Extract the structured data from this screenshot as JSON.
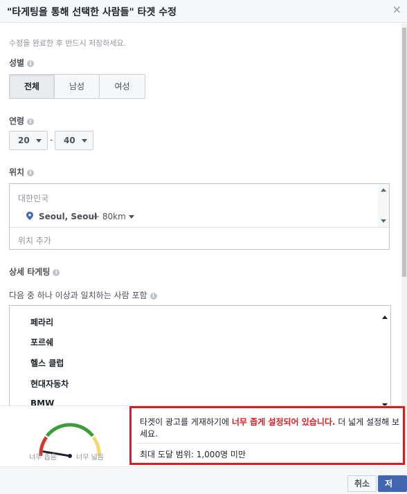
{
  "header": {
    "title": "\"타게팅을 통해 선택한 사람들\" 타겟 수정",
    "close_label": "×"
  },
  "hint": "수정을 완료한 후 반드시 저장하세요.",
  "gender": {
    "label": "성별",
    "options": [
      "전체",
      "남성",
      "여성"
    ],
    "selected": "전체"
  },
  "age": {
    "label": "연령",
    "min": "20",
    "max": "40",
    "separator": "-"
  },
  "location": {
    "label": "위치",
    "country": "대한민국",
    "city": "Seoul, Seoul",
    "radius": "+ 80km",
    "add_placeholder": "위치 추가"
  },
  "detailed_targeting": {
    "label": "상세 타게팅",
    "include_label": "다음 중 하나 이상과 일치하는 사람 포함",
    "items": [
      "페라리",
      "포르쉐",
      "헬스 클럽",
      "현대자동차",
      "BMW"
    ]
  },
  "audience": {
    "gauge_left_label": "너무 좁음",
    "gauge_right_label": "너무 넓음",
    "gauge_level": 0.1,
    "warning_prefix": "타겟이 광고를 게재하기에 ",
    "warning_strong": "너무 좁게 설정되어 있습니다.",
    "warning_suffix": " 더 넓게 설정해 보세요.",
    "reach": "최대 도달 범위: 1,000명 미만"
  },
  "footer": {
    "cancel_label": "취소",
    "save_label": "저장"
  },
  "colors": {
    "accent": "#4267b2",
    "warning": "#e11a22",
    "gauge_red": "#d23a2c",
    "gauge_green": "#3a9d3a",
    "gauge_yellow": "#f5d76e"
  },
  "info_icon": "i"
}
